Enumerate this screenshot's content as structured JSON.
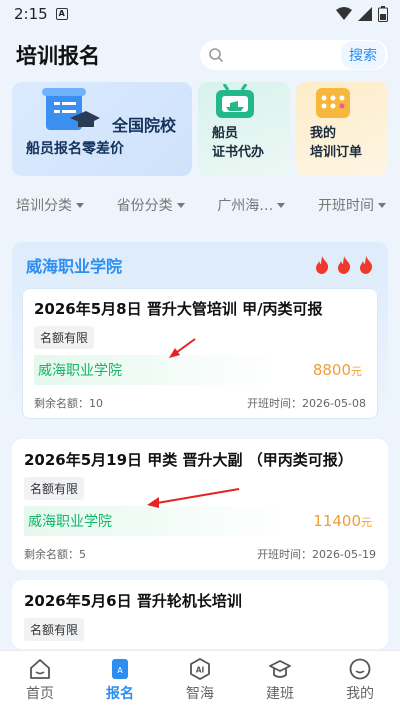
{
  "status": {
    "time": "2:15",
    "notif_badge": "A"
  },
  "header": {
    "title": "培训报名",
    "search_placeholder": "",
    "search_button": "搜索"
  },
  "promos": {
    "main": {
      "title": "全国院校",
      "subtitle": "船员报名零差价"
    },
    "cert": {
      "label_line1": "船员",
      "label_line2": "证书代办"
    },
    "orders": {
      "label_line1": "我的",
      "label_line2": "培训订单"
    }
  },
  "filters": [
    {
      "label": "培训分类"
    },
    {
      "label": "省份分类"
    },
    {
      "label": "广州海…"
    },
    {
      "label": "开班时间"
    }
  ],
  "school": {
    "name": "威海职业学院",
    "courses": [
      {
        "title": "2026年5月8日 晋升大管培训 甲/丙类可报",
        "tag": "名额有限",
        "org": "威海职业学院",
        "price": "8800",
        "unit": "元",
        "remaining": "剩余名额：10",
        "start": "开班时间：2026-05-08"
      }
    ]
  },
  "courses": [
    {
      "title": "2026年5月19日 甲类 晋升大副 （甲丙类可报）",
      "tag": "名额有限",
      "org": "威海职业学院",
      "price": "11400",
      "unit": "元",
      "remaining": "剩余名额：5",
      "start": "开班时间：2026-05-19"
    },
    {
      "title": "2026年5月6日 晋升轮机长培训",
      "tag": "名额有限"
    }
  ],
  "tabbar": [
    {
      "label": "首页",
      "icon": "home-icon"
    },
    {
      "label": "报名",
      "icon": "signup-icon",
      "active": true
    },
    {
      "label": "智海",
      "icon": "ai-icon"
    },
    {
      "label": "建班",
      "icon": "grad-cap-icon"
    },
    {
      "label": "我的",
      "icon": "profile-icon"
    }
  ],
  "colors": {
    "accent": "#2b8ef0",
    "org_green": "#16b568",
    "price_orange": "#f29d38",
    "annotation_red": "#e52421"
  }
}
